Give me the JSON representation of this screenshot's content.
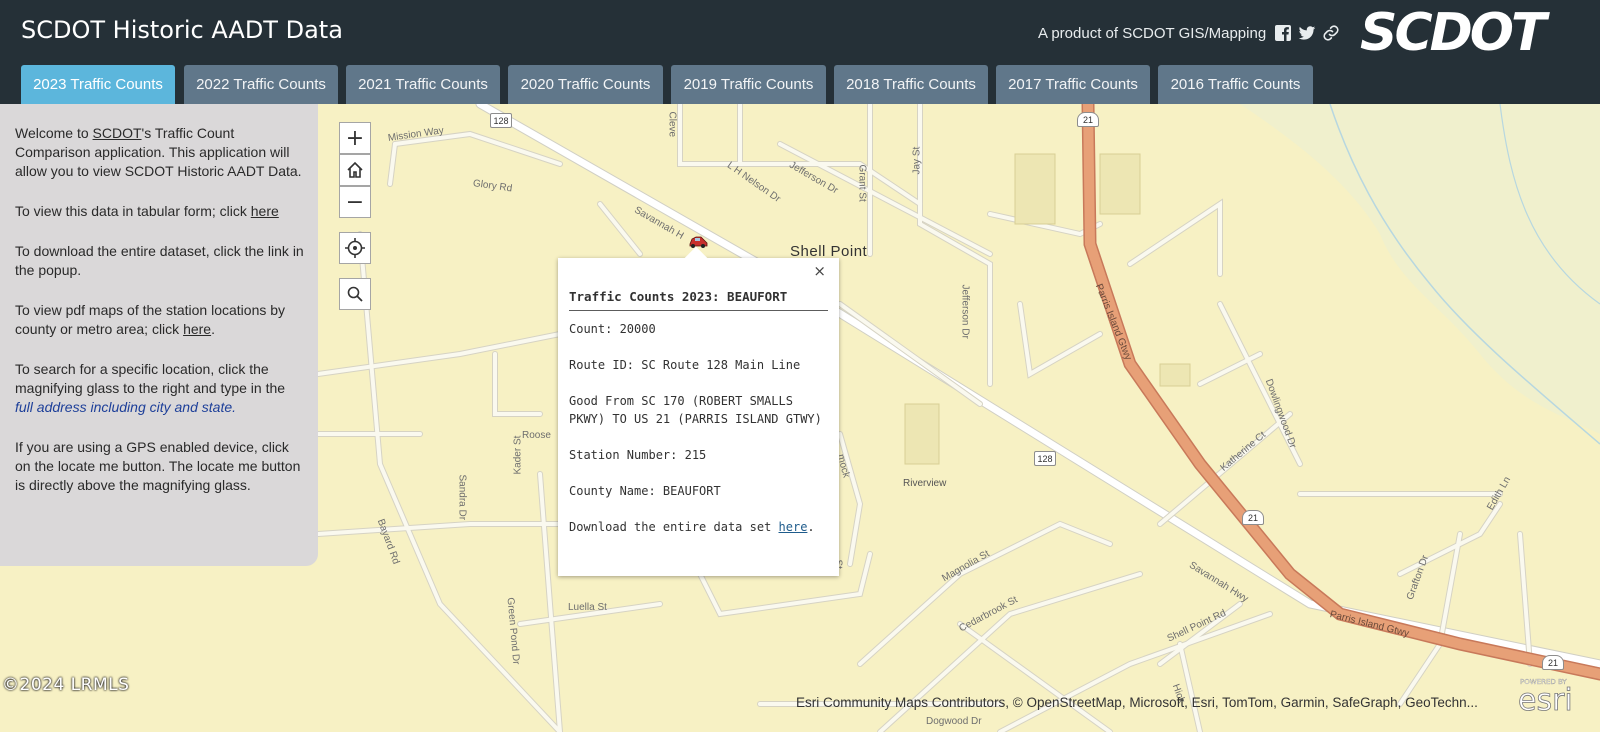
{
  "header": {
    "title": "SCDOT Historic AADT Data",
    "byline": "A product of SCDOT GIS/Mapping",
    "logo_text": "SCDOT",
    "icons": [
      "facebook-icon",
      "twitter-icon",
      "link-icon"
    ]
  },
  "tabs": [
    {
      "label": "2023 Traffic Counts",
      "active": true
    },
    {
      "label": "2022 Traffic Counts",
      "active": false
    },
    {
      "label": "2021 Traffic Counts",
      "active": false
    },
    {
      "label": "2020 Traffic Counts",
      "active": false
    },
    {
      "label": "2019 Traffic Counts",
      "active": false
    },
    {
      "label": "2018 Traffic Counts",
      "active": false
    },
    {
      "label": "2017 Traffic Counts",
      "active": false
    },
    {
      "label": "2016 Traffic Counts",
      "active": false
    }
  ],
  "panel": {
    "p1_a": "Welcome to ",
    "p1_link": "SCDOT",
    "p1_b": "'s Traffic Count Comparison application. This application will allow you to view SCDOT Historic AADT Data.",
    "p2_a": "To view this data in tabular form; click ",
    "p2_link": "here",
    "p3": "To download the entire dataset, click the link in the popup.",
    "p4_a": "To view pdf maps of the station locations by county or metro area; click ",
    "p4_link": "here",
    "p4_b": ".",
    "p5_a": "To search for a specific location, click the magnifying glass to the right and type in the ",
    "p5_hl": "full address including city and state.",
    "p6": "If you are using a GPS enabled device, click on the locate me button. The locate me button is directly above the magnifying glass."
  },
  "controls": {
    "zoom_in": "+",
    "zoom_out": "−"
  },
  "popup": {
    "close": "×",
    "title": "Traffic Counts 2023: BEAUFORT",
    "count": "Count: 20000",
    "route": "Route ID: SC Route 128 Main Line",
    "good_from": "Good From SC 170 (ROBERT SMALLS PKWY) TO US 21 (PARRIS ISLAND GTWY)",
    "station": "Station Number: 215",
    "county": "County Name: BEAUFORT",
    "download_a": "Download the entire data set ",
    "download_link": "here",
    "download_b": "."
  },
  "map": {
    "place_shell_point": "Shell Point",
    "place_riverview": "Riverview",
    "streets": {
      "mission_way": "Mission Way",
      "glory_rd": "Glory Rd",
      "savannah_hwy": "Savannah Hwy",
      "savannah_hwy_short": "Savannah H",
      "jefferson_dr": "Jefferson Dr",
      "lh_nelson_dr": "L H Nelson Dr",
      "grant_st": "Grant St",
      "jay_st": "Jay St",
      "cleve": "Cleve",
      "parris_island_gtwy": "Parris Island Gtwy",
      "dowlingwood_dr": "Dowlingwood Dr",
      "katherine_ct": "Katherine Ct",
      "edith_ln": "Edith Ln",
      "grafton_dr": "Grafton Dr",
      "bayard_rd": "Bayard Rd",
      "sandra_dr": "Sandra Dr",
      "kader_st": "Kader St",
      "roose": "Roose",
      "green_pond_dr": "Green Pond Dr",
      "luella_st": "Luella St",
      "magnolia_st": "Magnolia St",
      "cedarbrook_st": "Cedarbrook St",
      "shell_point_rd": "Shell Point Rd",
      "hick": "Hick",
      "dogwood_dr": "Dogwood Dr",
      "st": "St",
      "hmock": "mock"
    },
    "shields": [
      "128",
      "21",
      "128",
      "21",
      "21"
    ]
  },
  "attribution": "Esri Community Maps Contributors, © OpenStreetMap, Microsoft, Esri, TomTom, Garmin, SafeGraph, GeoTechn...",
  "copyright": "©2024 LRMLS",
  "esri_logo": {
    "powered": "POWERED BY",
    "name": "esri"
  }
}
